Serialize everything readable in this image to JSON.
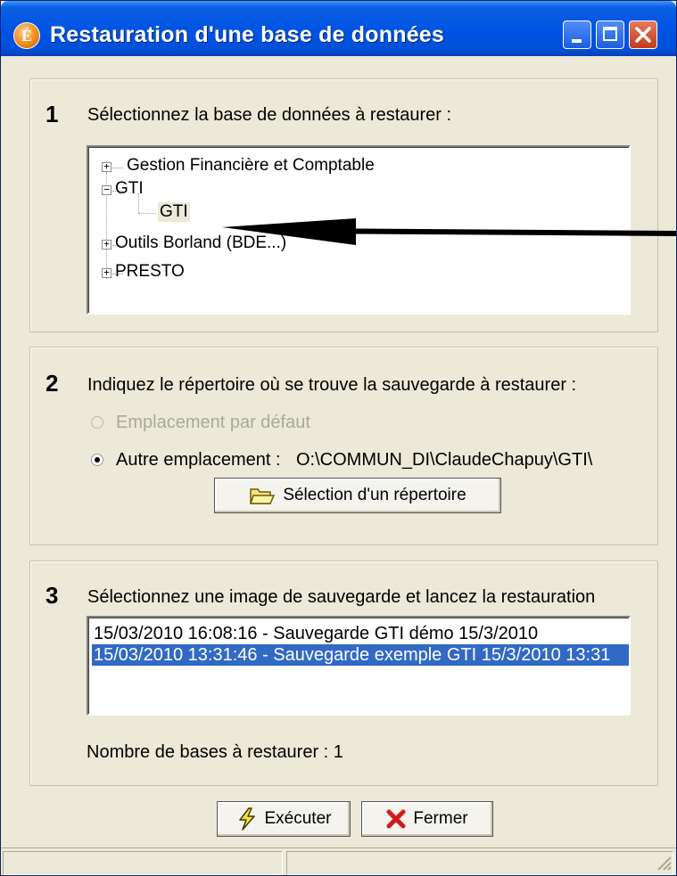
{
  "window": {
    "title": "Restauration d'une base de données",
    "app_icon_letter": "É"
  },
  "step1": {
    "number": "1",
    "label": "Sélectionnez la base de données à restaurer :",
    "tree": [
      {
        "label": "Gestion Financière et Comptable",
        "expander": "+",
        "level": 0
      },
      {
        "label": "GTI",
        "expander": "−",
        "level": 0
      },
      {
        "label": "GTI",
        "expander": "",
        "level": 1,
        "selected": true
      },
      {
        "label": "Outils Borland (BDE...)",
        "expander": "+",
        "level": 0
      },
      {
        "label": "PRESTO",
        "expander": "+",
        "level": 0
      }
    ]
  },
  "step2": {
    "number": "2",
    "label": "Indiquez le répertoire où se trouve la sauvegarde à restaurer :",
    "option_default": "Emplacement par défaut",
    "option_other": "Autre emplacement :",
    "path": "O:\\COMMUN_DI\\ClaudeChapuy\\GTI\\",
    "select_dir_button": "Sélection d'un répertoire"
  },
  "step3": {
    "number": "3",
    "label": "Sélectionnez une image de sauvegarde et lancez la restauration",
    "backups": [
      "15/03/2010 16:08:16 - Sauvegarde GTI démo 15/3/2010",
      "15/03/2010 13:31:46 - Sauvegarde exemple GTI 15/3/2010 13:31"
    ],
    "selected_index": 1,
    "count_label": "Nombre de bases à restaurer : 1"
  },
  "buttons": {
    "execute": "Exécuter",
    "close": "Fermer"
  },
  "colors": {
    "titlebar": "#0054e3",
    "selection": "#316ac5",
    "dialog_bg": "#ece9d8"
  }
}
